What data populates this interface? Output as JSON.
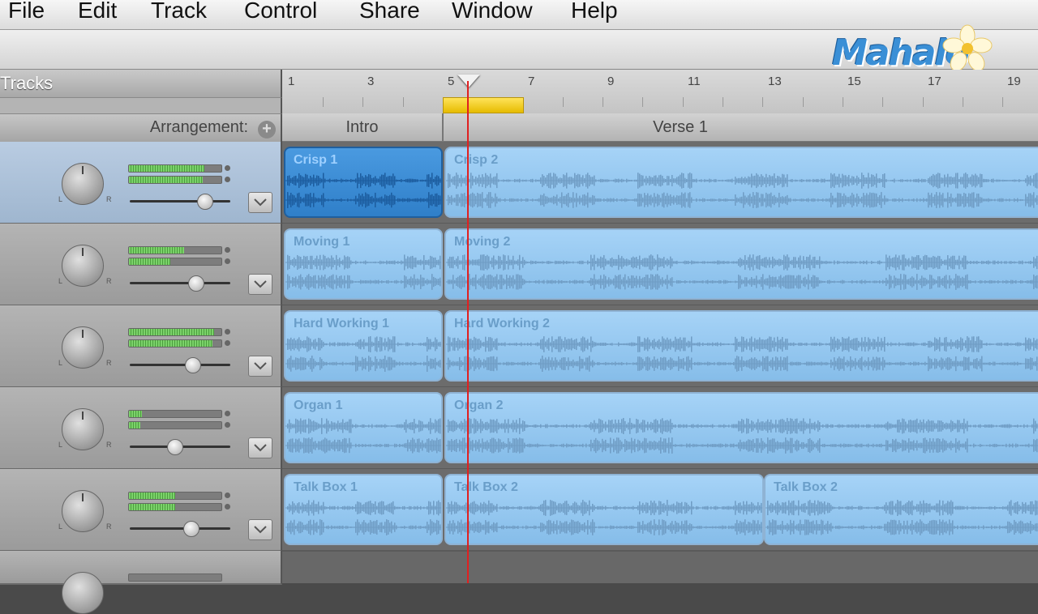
{
  "menu": [
    "File",
    "Edit",
    "Track",
    "Control",
    "Share",
    "Window",
    "Help"
  ],
  "logo": "Mahalo",
  "tracks_header": "Tracks",
  "arrangement_label": "Arrangement:",
  "arrangement_add": "+",
  "ruler_labels": [
    "1",
    "3",
    "5",
    "7",
    "9",
    "11",
    "13",
    "15",
    "17",
    "19"
  ],
  "sections": [
    "Intro",
    "Verse 1"
  ],
  "tracks": [
    {
      "meter1": 0.82,
      "meter2": 0.8,
      "volume": 0.75,
      "selected": true
    },
    {
      "meter1": 0.6,
      "meter2": 0.45,
      "volume": 0.65,
      "selected": false
    },
    {
      "meter1": 0.92,
      "meter2": 0.9,
      "volume": 0.62,
      "selected": false
    },
    {
      "meter1": 0.14,
      "meter2": 0.12,
      "volume": 0.42,
      "selected": false
    },
    {
      "meter1": 0.5,
      "meter2": 0.5,
      "volume": 0.6,
      "selected": false
    }
  ],
  "regions": [
    [
      {
        "label": "Crisp 1",
        "selected": true
      },
      {
        "label": "Crisp 2",
        "selected": false
      }
    ],
    [
      {
        "label": "Moving 1",
        "selected": false
      },
      {
        "label": "Moving 2",
        "selected": false
      }
    ],
    [
      {
        "label": "Hard Working 1",
        "selected": false
      },
      {
        "label": "Hard Working 2",
        "selected": false
      }
    ],
    [
      {
        "label": "Organ 1",
        "selected": false
      },
      {
        "label": "Organ 2",
        "selected": false
      }
    ],
    [
      {
        "label": "Talk Box 1",
        "selected": false
      },
      {
        "label": "Talk Box 2",
        "selected": false
      },
      {
        "label": "Talk Box 2",
        "selected": false
      }
    ]
  ],
  "colors": {
    "playhead": "#e02020",
    "cycle": "#f5d020",
    "region": "#9ccbf2",
    "region_selected": "#3a8ad6"
  }
}
